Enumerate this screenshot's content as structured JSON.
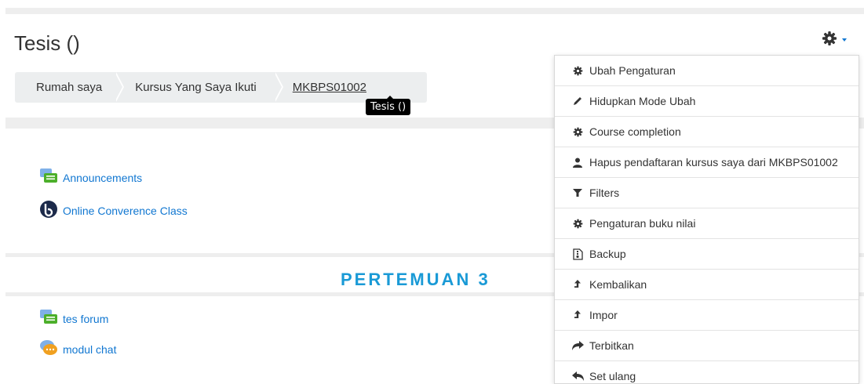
{
  "page": {
    "title": "Tesis ()"
  },
  "breadcrumb": {
    "items": [
      "Rumah saya",
      "Kursus Yang Saya Ikuti",
      "MKBPS01002"
    ],
    "tooltip": "Tesis ()"
  },
  "activities": {
    "top": [
      {
        "label": "Announcements",
        "icon": "forum-icon"
      },
      {
        "label": "Online Converence Class",
        "icon": "bigbluebutton-icon"
      }
    ],
    "section_title": "PERTEMUAN 3",
    "section": [
      {
        "label": "tes forum",
        "icon": "forum-icon"
      },
      {
        "label": "modul chat",
        "icon": "chat-icon"
      }
    ]
  },
  "menu": {
    "items": [
      {
        "label": "Ubah Pengaturan",
        "icon": "gear-icon"
      },
      {
        "label": "Hidupkan Mode Ubah",
        "icon": "pencil-icon"
      },
      {
        "label": "Course completion",
        "icon": "gear-icon"
      },
      {
        "label": "Hapus pendaftaran kursus saya dari MKBPS01002",
        "icon": "user-icon"
      },
      {
        "label": "Filters",
        "icon": "filter-icon"
      },
      {
        "label": "Pengaturan buku nilai",
        "icon": "gear-icon"
      },
      {
        "label": "Backup",
        "icon": "file-archive-icon"
      },
      {
        "label": "Kembalikan",
        "icon": "upload-icon"
      },
      {
        "label": "Impor",
        "icon": "upload-icon"
      },
      {
        "label": "Terbitkan",
        "icon": "share-icon"
      },
      {
        "label": "Set ulang",
        "icon": "reset-icon"
      }
    ]
  },
  "colors": {
    "link": "#1177d1",
    "section": "#1a9ad6",
    "band": "#eeeeee"
  }
}
